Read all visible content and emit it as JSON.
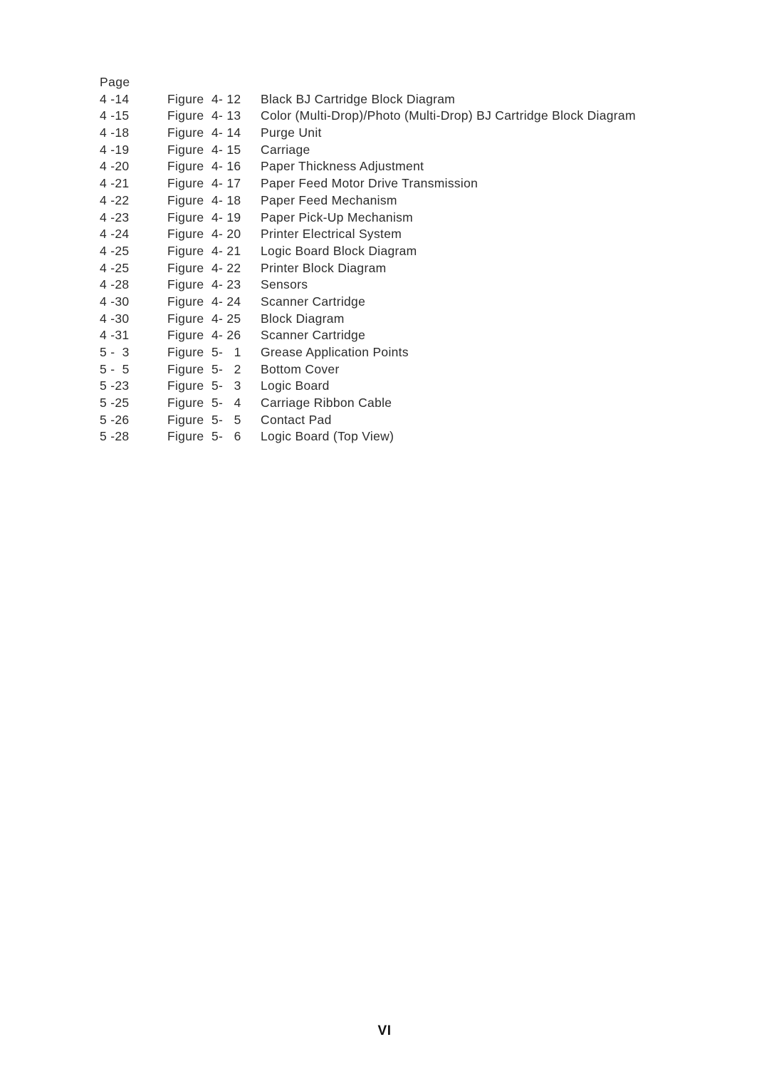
{
  "document": {
    "page_label": "VI",
    "column_headers": {
      "page": "Page"
    }
  },
  "figure_list": {
    "rows": [
      {
        "page": "4 -14",
        "figure_label": "Figure",
        "figure_number": "4- 12",
        "title": "Black BJ Cartridge Block Diagram"
      },
      {
        "page": "4 -15",
        "figure_label": "Figure",
        "figure_number": "4- 13",
        "title": "Color (Multi-Drop)/Photo (Multi-Drop) BJ Cartridge Block Diagram"
      },
      {
        "page": "4 -18",
        "figure_label": "Figure",
        "figure_number": "4- 14",
        "title": "Purge Unit"
      },
      {
        "page": "4 -19",
        "figure_label": "Figure",
        "figure_number": "4- 15",
        "title": "Carriage"
      },
      {
        "page": "4 -20",
        "figure_label": "Figure",
        "figure_number": "4- 16",
        "title": "Paper Thickness Adjustment"
      },
      {
        "page": "4 -21",
        "figure_label": "Figure",
        "figure_number": "4- 17",
        "title": "Paper Feed Motor Drive Transmission"
      },
      {
        "page": "4 -22",
        "figure_label": "Figure",
        "figure_number": "4- 18",
        "title": "Paper Feed Mechanism"
      },
      {
        "page": "4 -23",
        "figure_label": "Figure",
        "figure_number": "4- 19",
        "title": "Paper Pick-Up Mechanism"
      },
      {
        "page": "4 -24",
        "figure_label": "Figure",
        "figure_number": "4- 20",
        "title": "Printer Electrical System"
      },
      {
        "page": "4 -25",
        "figure_label": "Figure",
        "figure_number": "4- 21",
        "title": "Logic Board Block Diagram"
      },
      {
        "page": "4 -25",
        "figure_label": "Figure",
        "figure_number": "4- 22",
        "title": "Printer Block Diagram"
      },
      {
        "page": "4 -28",
        "figure_label": "Figure",
        "figure_number": "4- 23",
        "title": "Sensors"
      },
      {
        "page": "4 -30",
        "figure_label": "Figure",
        "figure_number": "4- 24",
        "title": "Scanner Cartridge"
      },
      {
        "page": "4 -30",
        "figure_label": "Figure",
        "figure_number": "4- 25",
        "title": "Block Diagram"
      },
      {
        "page": "4 -31",
        "figure_label": "Figure",
        "figure_number": "4- 26",
        "title": "Scanner Cartridge"
      },
      {
        "page": "5 -  3",
        "figure_label": "Figure",
        "figure_number": "5-   1",
        "title": "Grease Application Points"
      },
      {
        "page": "5 -  5",
        "figure_label": "Figure",
        "figure_number": "5-   2",
        "title": "Bottom Cover"
      },
      {
        "page": "5 -23",
        "figure_label": "Figure",
        "figure_number": "5-   3",
        "title": "Logic Board"
      },
      {
        "page": "5 -25",
        "figure_label": "Figure",
        "figure_number": "5-   4",
        "title": "Carriage Ribbon Cable"
      },
      {
        "page": "5 -26",
        "figure_label": "Figure",
        "figure_number": "5-   5",
        "title": "Contact Pad"
      },
      {
        "page": "5 -28",
        "figure_label": "Figure",
        "figure_number": "5-   6",
        "title": "Logic Board (Top View)"
      }
    ]
  }
}
